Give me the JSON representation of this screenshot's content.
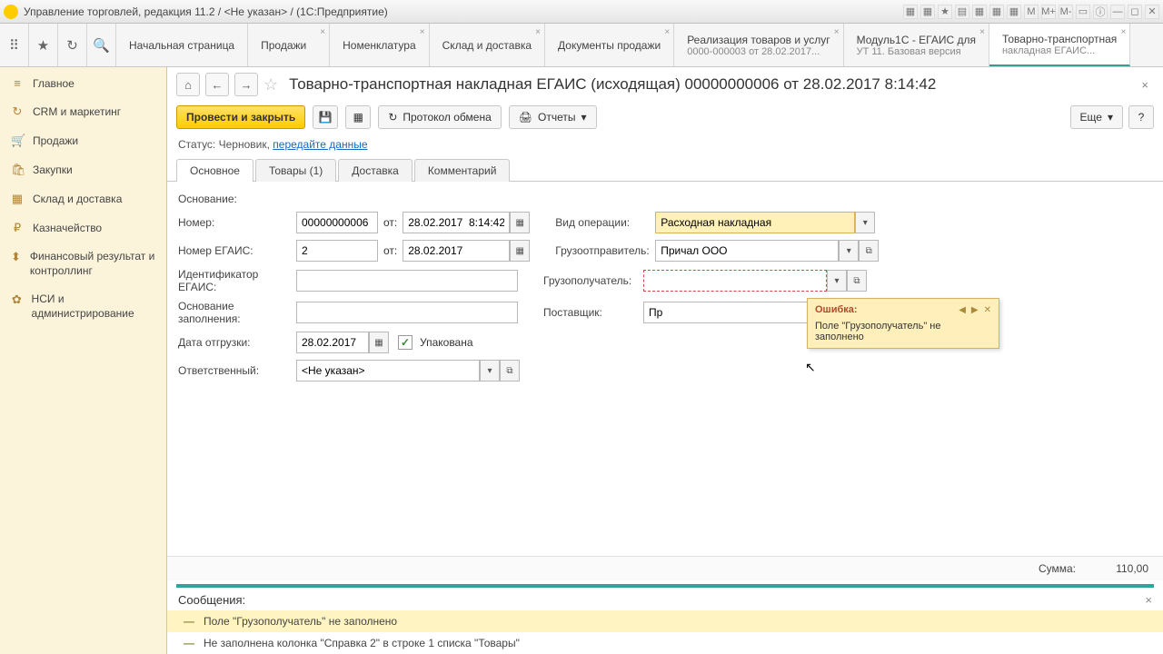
{
  "window": {
    "title": "Управление торговлей, редакция 11.2 / <Не указан> / (1С:Предприятие)"
  },
  "topTabs": [
    {
      "label": "Начальная страница",
      "sub": ""
    },
    {
      "label": "Продажи",
      "sub": ""
    },
    {
      "label": "Номенклатура",
      "sub": ""
    },
    {
      "label": "Склад и доставка",
      "sub": ""
    },
    {
      "label": "Документы продажи",
      "sub": ""
    },
    {
      "label": "Реализация товаров и услуг",
      "sub": "0000-000003 от 28.02.2017..."
    },
    {
      "label": "Модуль1С - ЕГАИС для",
      "sub": "УТ 11. Базовая версия"
    },
    {
      "label": "Товарно-транспортная",
      "sub": "накладная ЕГАИС..."
    }
  ],
  "sidebar": [
    {
      "icon": "≡",
      "label": "Главное"
    },
    {
      "icon": "↻",
      "label": "CRM и маркетинг"
    },
    {
      "icon": "🛒",
      "label": "Продажи"
    },
    {
      "icon": "🛍",
      "label": "Закупки"
    },
    {
      "icon": "▦",
      "label": "Склад и доставка"
    },
    {
      "icon": "₽",
      "label": "Казначейство"
    },
    {
      "icon": "⬍",
      "label": "Финансовый результат и контроллинг"
    },
    {
      "icon": "✿",
      "label": "НСИ и администрирование"
    }
  ],
  "doc": {
    "title": "Товарно-транспортная накладная ЕГАИС (исходящая) 00000000006 от 28.02.2017 8:14:42"
  },
  "toolbar": {
    "submit": "Провести и закрыть",
    "protocol": "Протокол обмена",
    "reports": "Отчеты",
    "more": "Еще"
  },
  "status": {
    "label": "Статус:",
    "value": "Черновик,",
    "link": "передайте данные"
  },
  "tabs": {
    "t0": "Основное",
    "t1": "Товары (1)",
    "t2": "Доставка",
    "t3": "Комментарий"
  },
  "form": {
    "basis_lbl": "Основание:",
    "number_lbl": "Номер:",
    "number": "00000000006",
    "from_lbl": "от:",
    "datetime": "28.02.2017  8:14:42",
    "op_lbl": "Вид операции:",
    "op_val": "Расходная накладная",
    "egais_num_lbl": "Номер ЕГАИС:",
    "egais_num": "2",
    "egais_date": "28.02.2017",
    "shipper_lbl": "Грузоотправитель:",
    "shipper": "Причал ООО",
    "egais_id_lbl": "Идентификатор ЕГАИС:",
    "consignee_lbl": "Грузополучатель:",
    "consignee": "",
    "fill_basis_lbl": "Основание заполнения:",
    "supplier_lbl": "Поставщик:",
    "supplier": "Пр",
    "ship_date_lbl": "Дата отгрузки:",
    "ship_date": "28.02.2017",
    "packed_lbl": "Упакована",
    "resp_lbl": "Ответственный:",
    "resp": "<Не указан>"
  },
  "tooltip": {
    "title": "Ошибка:",
    "text": "Поле \"Грузополучатель\" не заполнено"
  },
  "sum": {
    "label": "Сумма:",
    "value": "110,00"
  },
  "messages": {
    "header": "Сообщения:",
    "m0": "Поле \"Грузополучатель\" не заполнено",
    "m1": "Не заполнена колонка \"Справка 2\" в строке 1 списка \"Товары\""
  }
}
